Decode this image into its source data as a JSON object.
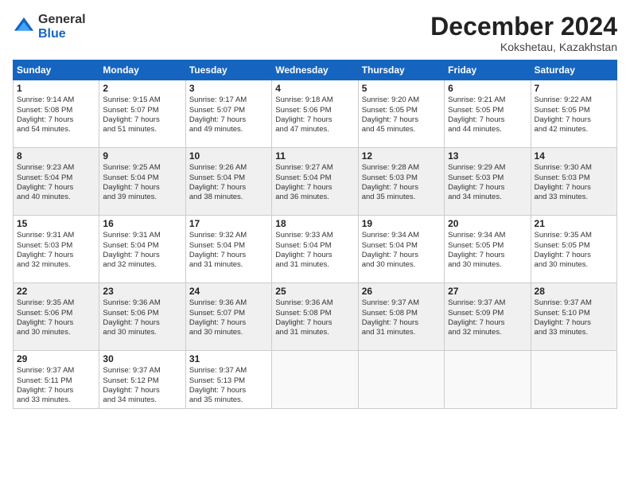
{
  "logo": {
    "general": "General",
    "blue": "Blue"
  },
  "header": {
    "month": "December 2024",
    "location": "Kokshetau, Kazakhstan"
  },
  "weekdays": [
    "Sunday",
    "Monday",
    "Tuesday",
    "Wednesday",
    "Thursday",
    "Friday",
    "Saturday"
  ],
  "weeks": [
    [
      {
        "day": "1",
        "lines": [
          "Sunrise: 9:14 AM",
          "Sunset: 5:08 PM",
          "Daylight: 7 hours",
          "and 54 minutes."
        ]
      },
      {
        "day": "2",
        "lines": [
          "Sunrise: 9:15 AM",
          "Sunset: 5:07 PM",
          "Daylight: 7 hours",
          "and 51 minutes."
        ]
      },
      {
        "day": "3",
        "lines": [
          "Sunrise: 9:17 AM",
          "Sunset: 5:07 PM",
          "Daylight: 7 hours",
          "and 49 minutes."
        ]
      },
      {
        "day": "4",
        "lines": [
          "Sunrise: 9:18 AM",
          "Sunset: 5:06 PM",
          "Daylight: 7 hours",
          "and 47 minutes."
        ]
      },
      {
        "day": "5",
        "lines": [
          "Sunrise: 9:20 AM",
          "Sunset: 5:05 PM",
          "Daylight: 7 hours",
          "and 45 minutes."
        ]
      },
      {
        "day": "6",
        "lines": [
          "Sunrise: 9:21 AM",
          "Sunset: 5:05 PM",
          "Daylight: 7 hours",
          "and 44 minutes."
        ]
      },
      {
        "day": "7",
        "lines": [
          "Sunrise: 9:22 AM",
          "Sunset: 5:05 PM",
          "Daylight: 7 hours",
          "and 42 minutes."
        ]
      }
    ],
    [
      {
        "day": "8",
        "lines": [
          "Sunrise: 9:23 AM",
          "Sunset: 5:04 PM",
          "Daylight: 7 hours",
          "and 40 minutes."
        ]
      },
      {
        "day": "9",
        "lines": [
          "Sunrise: 9:25 AM",
          "Sunset: 5:04 PM",
          "Daylight: 7 hours",
          "and 39 minutes."
        ]
      },
      {
        "day": "10",
        "lines": [
          "Sunrise: 9:26 AM",
          "Sunset: 5:04 PM",
          "Daylight: 7 hours",
          "and 38 minutes."
        ]
      },
      {
        "day": "11",
        "lines": [
          "Sunrise: 9:27 AM",
          "Sunset: 5:04 PM",
          "Daylight: 7 hours",
          "and 36 minutes."
        ]
      },
      {
        "day": "12",
        "lines": [
          "Sunrise: 9:28 AM",
          "Sunset: 5:03 PM",
          "Daylight: 7 hours",
          "and 35 minutes."
        ]
      },
      {
        "day": "13",
        "lines": [
          "Sunrise: 9:29 AM",
          "Sunset: 5:03 PM",
          "Daylight: 7 hours",
          "and 34 minutes."
        ]
      },
      {
        "day": "14",
        "lines": [
          "Sunrise: 9:30 AM",
          "Sunset: 5:03 PM",
          "Daylight: 7 hours",
          "and 33 minutes."
        ]
      }
    ],
    [
      {
        "day": "15",
        "lines": [
          "Sunrise: 9:31 AM",
          "Sunset: 5:03 PM",
          "Daylight: 7 hours",
          "and 32 minutes."
        ]
      },
      {
        "day": "16",
        "lines": [
          "Sunrise: 9:31 AM",
          "Sunset: 5:04 PM",
          "Daylight: 7 hours",
          "and 32 minutes."
        ]
      },
      {
        "day": "17",
        "lines": [
          "Sunrise: 9:32 AM",
          "Sunset: 5:04 PM",
          "Daylight: 7 hours",
          "and 31 minutes."
        ]
      },
      {
        "day": "18",
        "lines": [
          "Sunrise: 9:33 AM",
          "Sunset: 5:04 PM",
          "Daylight: 7 hours",
          "and 31 minutes."
        ]
      },
      {
        "day": "19",
        "lines": [
          "Sunrise: 9:34 AM",
          "Sunset: 5:04 PM",
          "Daylight: 7 hours",
          "and 30 minutes."
        ]
      },
      {
        "day": "20",
        "lines": [
          "Sunrise: 9:34 AM",
          "Sunset: 5:05 PM",
          "Daylight: 7 hours",
          "and 30 minutes."
        ]
      },
      {
        "day": "21",
        "lines": [
          "Sunrise: 9:35 AM",
          "Sunset: 5:05 PM",
          "Daylight: 7 hours",
          "and 30 minutes."
        ]
      }
    ],
    [
      {
        "day": "22",
        "lines": [
          "Sunrise: 9:35 AM",
          "Sunset: 5:06 PM",
          "Daylight: 7 hours",
          "and 30 minutes."
        ]
      },
      {
        "day": "23",
        "lines": [
          "Sunrise: 9:36 AM",
          "Sunset: 5:06 PM",
          "Daylight: 7 hours",
          "and 30 minutes."
        ]
      },
      {
        "day": "24",
        "lines": [
          "Sunrise: 9:36 AM",
          "Sunset: 5:07 PM",
          "Daylight: 7 hours",
          "and 30 minutes."
        ]
      },
      {
        "day": "25",
        "lines": [
          "Sunrise: 9:36 AM",
          "Sunset: 5:08 PM",
          "Daylight: 7 hours",
          "and 31 minutes."
        ]
      },
      {
        "day": "26",
        "lines": [
          "Sunrise: 9:37 AM",
          "Sunset: 5:08 PM",
          "Daylight: 7 hours",
          "and 31 minutes."
        ]
      },
      {
        "day": "27",
        "lines": [
          "Sunrise: 9:37 AM",
          "Sunset: 5:09 PM",
          "Daylight: 7 hours",
          "and 32 minutes."
        ]
      },
      {
        "day": "28",
        "lines": [
          "Sunrise: 9:37 AM",
          "Sunset: 5:10 PM",
          "Daylight: 7 hours",
          "and 33 minutes."
        ]
      }
    ],
    [
      {
        "day": "29",
        "lines": [
          "Sunrise: 9:37 AM",
          "Sunset: 5:11 PM",
          "Daylight: 7 hours",
          "and 33 minutes."
        ]
      },
      {
        "day": "30",
        "lines": [
          "Sunrise: 9:37 AM",
          "Sunset: 5:12 PM",
          "Daylight: 7 hours",
          "and 34 minutes."
        ]
      },
      {
        "day": "31",
        "lines": [
          "Sunrise: 9:37 AM",
          "Sunset: 5:13 PM",
          "Daylight: 7 hours",
          "and 35 minutes."
        ]
      },
      null,
      null,
      null,
      null
    ]
  ]
}
